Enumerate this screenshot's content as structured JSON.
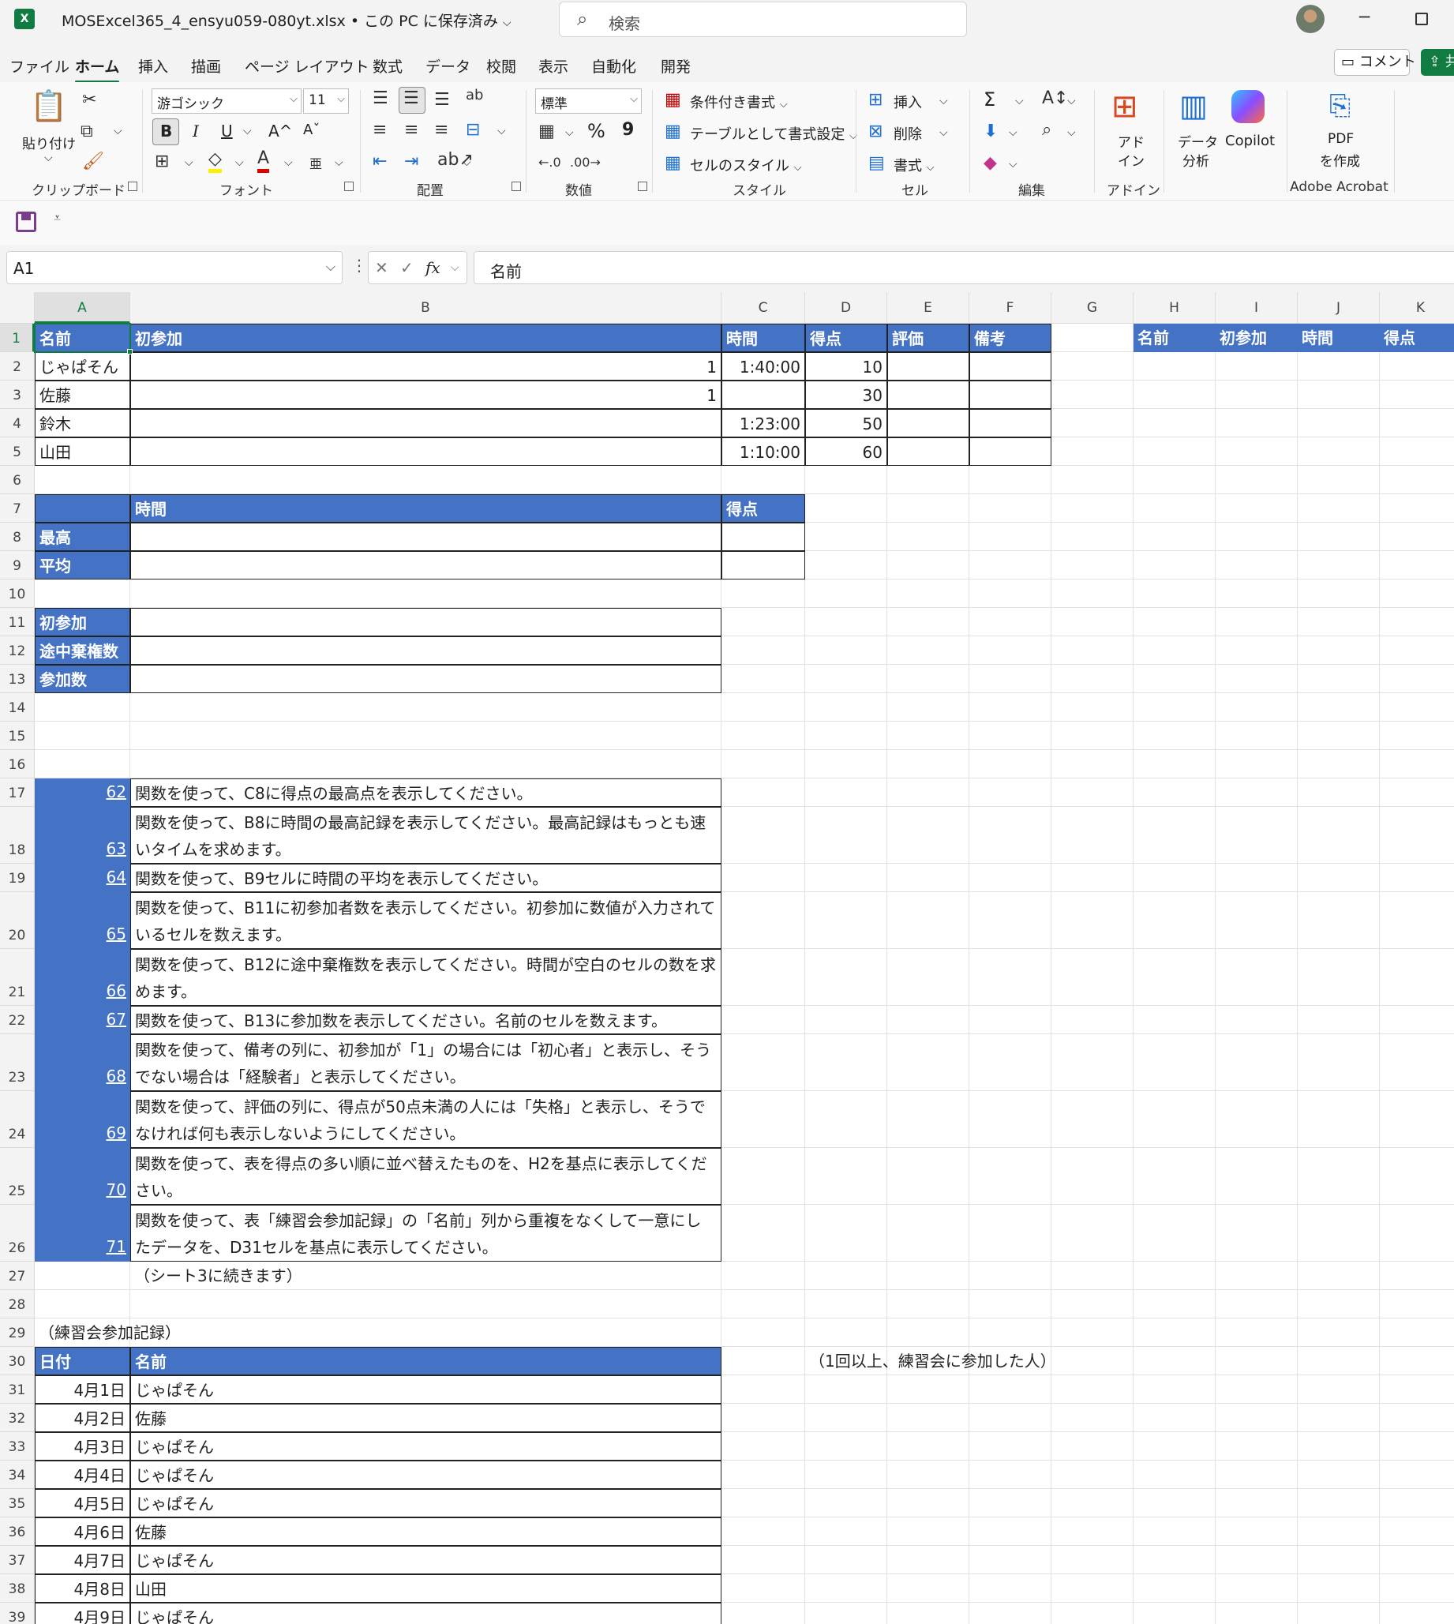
{
  "window": {
    "app_icon": "X",
    "title": "MOSExcel365_4_ensyu059-080yt.xlsx • この PC に保存済み",
    "search_placeholder": "検索"
  },
  "menu": {
    "tabs": [
      "ファイル",
      "ホーム",
      "挿入",
      "描画",
      "ページ レイアウト",
      "数式",
      "データ",
      "校閲",
      "表示",
      "自動化",
      "開発"
    ],
    "active": "ホーム",
    "comment_label": "コメント",
    "share_label": "共"
  },
  "ribbon": {
    "clipboard": {
      "label": "クリップボード",
      "paste": "貼り付け"
    },
    "font": {
      "label": "フォント",
      "family": "游ゴシック",
      "size": "11",
      "bold": "B",
      "italic": "I",
      "underline": "U",
      "grow": "A^",
      "shrink": "Aˇ"
    },
    "alignment": {
      "label": "配置"
    },
    "number": {
      "label": "数値",
      "format": "標準",
      "percent": "%",
      "comma": "9"
    },
    "styles": {
      "label": "スタイル",
      "conditional": "条件付き書式",
      "as_table": "テーブルとして書式設定",
      "cell_styles": "セルのスタイル"
    },
    "cells": {
      "label": "セル",
      "insert": "挿入",
      "delete": "削除",
      "format": "書式"
    },
    "editing": {
      "label": "編集",
      "sum": "Σ"
    },
    "addins": {
      "label": "アドイン",
      "button_line1": "アド",
      "button_line2": "イン"
    },
    "analysis": {
      "line1": "データ",
      "line2": "分析"
    },
    "copilot": {
      "label": "Copilot"
    },
    "acrobat": {
      "label": "Adobe Acrobat",
      "line1": "PDF",
      "line2": "を作成"
    }
  },
  "formula_bar": {
    "name_box": "A1",
    "fx": "fx",
    "content": "名前"
  },
  "sheet": {
    "columns": [
      "A",
      "B",
      "C",
      "D",
      "E",
      "F",
      "G",
      "H",
      "I",
      "J",
      "K"
    ],
    "rows": [
      "1",
      "2",
      "3",
      "4",
      "5",
      "6",
      "7",
      "8",
      "9",
      "10",
      "11",
      "12",
      "13",
      "14",
      "15",
      "16",
      "17",
      "18",
      "19",
      "20",
      "21",
      "22",
      "23",
      "24",
      "25",
      "26",
      "27",
      "28",
      "29",
      "30",
      "31",
      "32",
      "33",
      "34",
      "35",
      "36",
      "37",
      "38",
      "39"
    ],
    "header_row": [
      "名前",
      "初参加",
      "時間",
      "得点",
      "評価",
      "備考"
    ],
    "right_header": [
      "名前",
      "初参加",
      "時間",
      "得点"
    ],
    "records": [
      {
        "name": "じゃぱそん",
        "first": "1",
        "time": "1:40:00",
        "score": "10"
      },
      {
        "name": "佐藤",
        "first": "1",
        "time": "",
        "score": "30"
      },
      {
        "name": "鈴木",
        "first": "",
        "time": "1:23:00",
        "score": "50"
      },
      {
        "name": "山田",
        "first": "",
        "time": "1:10:00",
        "score": "60"
      }
    ],
    "stats": {
      "col_time": "時間",
      "col_score": "得点",
      "max": "最高",
      "avg": "平均"
    },
    "counts": [
      "初参加",
      "途中棄権数",
      "参加数"
    ],
    "tasks": [
      {
        "no": "62",
        "text": "関数を使って、C8に得点の最高点を表示してください。"
      },
      {
        "no": "63",
        "text": "関数を使って、B8に時間の最高記録を表示してください。最高記録はもっとも速いタイムを求めます。"
      },
      {
        "no": "64",
        "text": "関数を使って、B9セルに時間の平均を表示してください。"
      },
      {
        "no": "65",
        "text": "関数を使って、B11に初参加者数を表示してください。初参加に数値が入力されているセルを数えます。"
      },
      {
        "no": "66",
        "text": "関数を使って、B12に途中棄権数を表示してください。時間が空白のセルの数を求めます。"
      },
      {
        "no": "67",
        "text": "関数を使って、B13に参加数を表示してください。名前のセルを数えます。"
      },
      {
        "no": "68",
        "text": "関数を使って、備考の列に、初参加が「1」の場合には「初心者」と表示し、そうでない場合は「経験者」と表示してください。"
      },
      {
        "no": "69",
        "text": "関数を使って、評価の列に、得点が50点未満の人には「失格」と表示し、そうでなければ何も表示しないようにしてください。"
      },
      {
        "no": "70",
        "text": "関数を使って、表を得点の多い順に並べ替えたものを、H2を基点に表示してください。"
      },
      {
        "no": "71",
        "text": "関数を使って、表「練習会参加記録」の「名前」列から重複をなくして一意にしたデータを、D31セルを基点に表示してください。"
      }
    ],
    "continue_note": "（シート3に続きます）",
    "log_title": "（練習会参加記録）",
    "log_header": [
      "日付",
      "名前"
    ],
    "log_note": "（1回以上、練習会に参加した人）",
    "log": [
      {
        "date": "4月1日",
        "name": "じゃぱそん"
      },
      {
        "date": "4月2日",
        "name": "佐藤"
      },
      {
        "date": "4月3日",
        "name": "じゃぱそん"
      },
      {
        "date": "4月4日",
        "name": "じゃぱそん"
      },
      {
        "date": "4月5日",
        "name": "じゃぱそん"
      },
      {
        "date": "4月6日",
        "name": "佐藤"
      },
      {
        "date": "4月7日",
        "name": "じゃぱそん"
      },
      {
        "date": "4月8日",
        "name": "山田"
      },
      {
        "date": "4月9日",
        "name": "じゃぱそん"
      }
    ]
  },
  "colors": {
    "excel_green": "#107c41",
    "header_blue": "#4472c4"
  }
}
